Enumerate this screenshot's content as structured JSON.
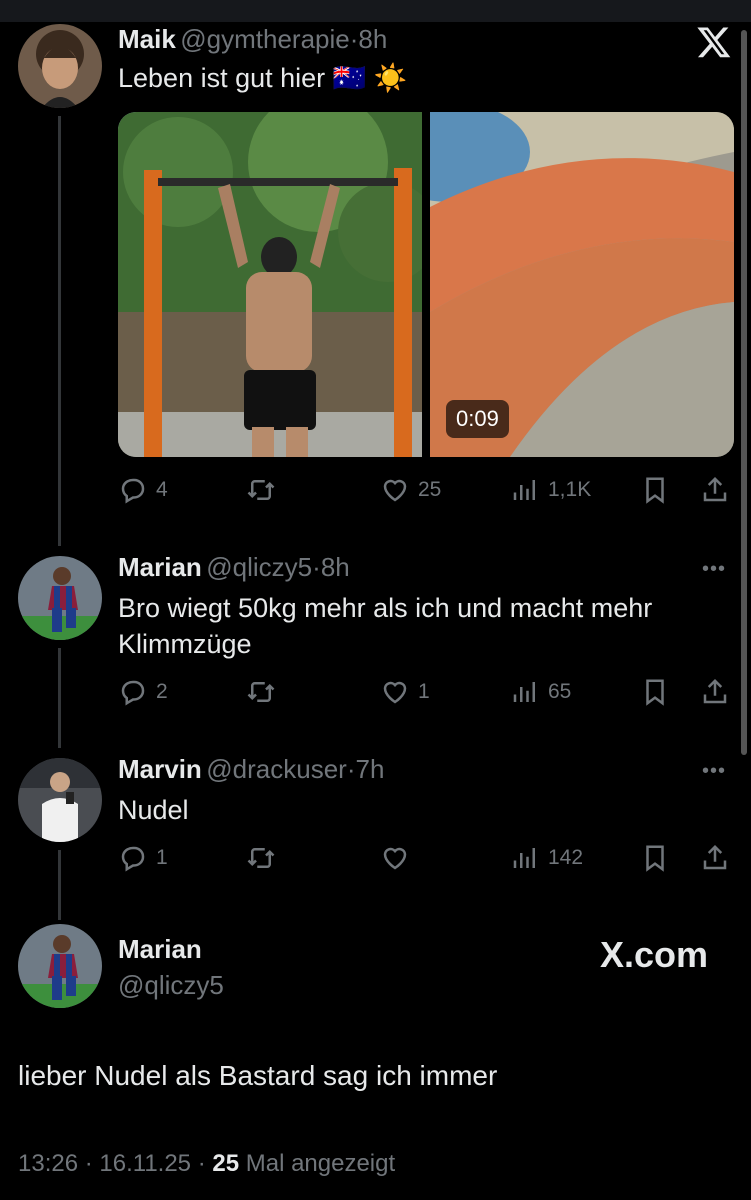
{
  "thread": [
    {
      "name": "Maik",
      "handle": "@gymtherapie",
      "time": "8h",
      "text": "Leben ist gut hier 🇦🇺 ☀️",
      "video_duration": "0:09",
      "stats": {
        "replies": "4",
        "reposts": "",
        "likes": "25",
        "views": "1,1K"
      }
    },
    {
      "name": "Marian",
      "handle": "@qliczy5",
      "time": "8h",
      "text": "Bro wiegt 50kg mehr als ich und macht mehr Klimmzüge",
      "stats": {
        "replies": "2",
        "reposts": "",
        "likes": "1",
        "views": "65"
      }
    },
    {
      "name": "Marvin",
      "handle": "@drackuser",
      "time": "7h",
      "text": "Nudel",
      "stats": {
        "replies": "1",
        "reposts": "",
        "likes": "",
        "views": "142"
      }
    }
  ],
  "main_tweet": {
    "name": "Marian",
    "handle": "@qliczy5",
    "text": "lieber Nudel als Bastard sag ich immer",
    "timestamp": "13:26 · 16.11.25 · ",
    "views_count": "25",
    "views_label": " Mal angezeigt",
    "watermark": "X.com"
  },
  "separator": "·",
  "more_label": "•••",
  "icons": [
    "x-logo-icon",
    "reply-icon",
    "repost-icon",
    "like-icon",
    "views-icon",
    "bookmark-icon",
    "share-icon"
  ],
  "colors": {
    "background": "#000000",
    "text": "#e7e9ea",
    "muted": "#71767b",
    "thread_line": "#333639"
  }
}
